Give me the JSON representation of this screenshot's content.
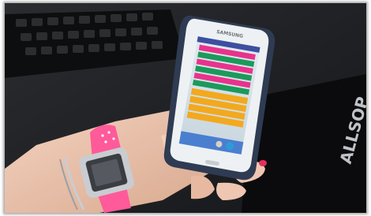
{
  "photo": {
    "phone_brand": "SAMSUNG",
    "mousepad_text": "ALLSOP",
    "screen_bars": [
      "#e8338c",
      "#1c9a5a",
      "#e8338c",
      "#1c9a5a",
      "#e8338c",
      "#1c9a5a",
      "#f2a91e",
      "#f2a91e",
      "#f2a91e",
      "#f2a91e"
    ],
    "watch_band_color": "#ff5a99",
    "nail_polish_color": "#e2305f"
  }
}
